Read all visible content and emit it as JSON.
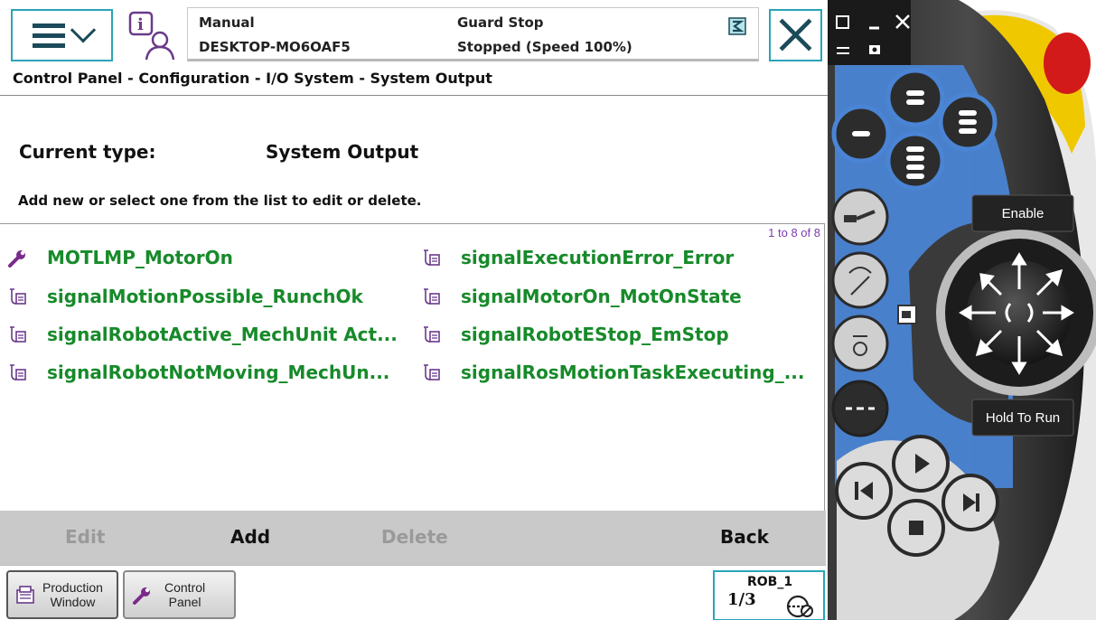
{
  "header": {
    "mode": "Manual",
    "controller_name": "DESKTOP-MO6OAF5",
    "guard_status": "Guard Stop",
    "run_state": "Stopped (Speed 100%)"
  },
  "breadcrumb": "Control Panel - Configuration - I/O System - System Output",
  "current_type": {
    "label": "Current type:",
    "value": "System Output"
  },
  "instructions": "Add new or select one from the list to edit or delete.",
  "list": {
    "count": "1 to 8 of 8",
    "items": [
      {
        "label": "MOTLMP_MotorOn",
        "icon": "wrench-icon"
      },
      {
        "label": "signalExecutionError_Error",
        "icon": "signal-icon"
      },
      {
        "label": "signalMotionPossible_RunchOk",
        "icon": "signal-icon"
      },
      {
        "label": "signalMotorOn_MotOnState",
        "icon": "signal-icon"
      },
      {
        "label": "signalRobotActive_MechUnit Act...",
        "icon": "signal-icon"
      },
      {
        "label": "signalRobotEStop_EmStop",
        "icon": "signal-icon"
      },
      {
        "label": "signalRobotNotMoving_MechUn...",
        "icon": "signal-icon"
      },
      {
        "label": "signalRosMotionTaskExecuting_...",
        "icon": "signal-icon"
      }
    ]
  },
  "commands": {
    "edit": "Edit",
    "add": "Add",
    "delete": "Delete",
    "back": "Back"
  },
  "taskbar": {
    "production_window": "Production\nWindow",
    "control_panel": "Control\nPanel",
    "robot": "ROB_1",
    "increment": "1/3"
  },
  "pendant": {
    "enable_label": "Enable",
    "hold_to_run_label": "Hold To Run"
  },
  "colors": {
    "accent": "#2aa4b8",
    "list_text": "#178a2a",
    "count_text": "#7b3bb0",
    "command_bar": "#c9c9c9",
    "pendant_blue": "#4a84d4"
  }
}
